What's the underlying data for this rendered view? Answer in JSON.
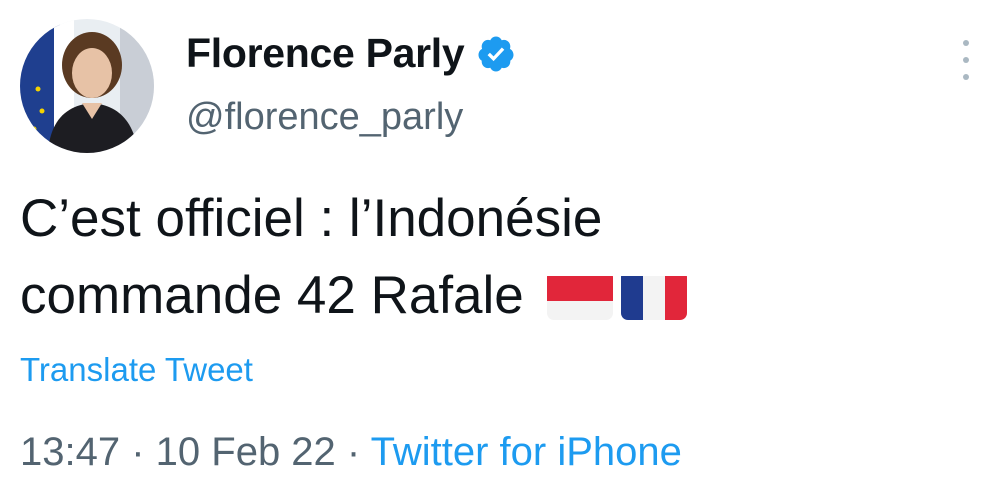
{
  "author": {
    "display_name": "Florence Parly",
    "handle": "@florence_parly",
    "verified": true,
    "avatar_icon": "avatar"
  },
  "menu": {
    "icon": "more-vertical-icon"
  },
  "tweet": {
    "text_line1": "C’est officiel : l’Indonésie",
    "text_line2": "commande 42 Rafale",
    "emoji": [
      "indonesia-flag-icon",
      "france-flag-icon"
    ]
  },
  "translate_label": "Translate Tweet",
  "meta": {
    "time": "13:47",
    "sep1": " · ",
    "date": "10 Feb 22",
    "sep2": " · ",
    "source": "Twitter for iPhone"
  },
  "colors": {
    "accent": "#1d9bf0",
    "text": "#0f1419",
    "secondary": "#536471"
  }
}
